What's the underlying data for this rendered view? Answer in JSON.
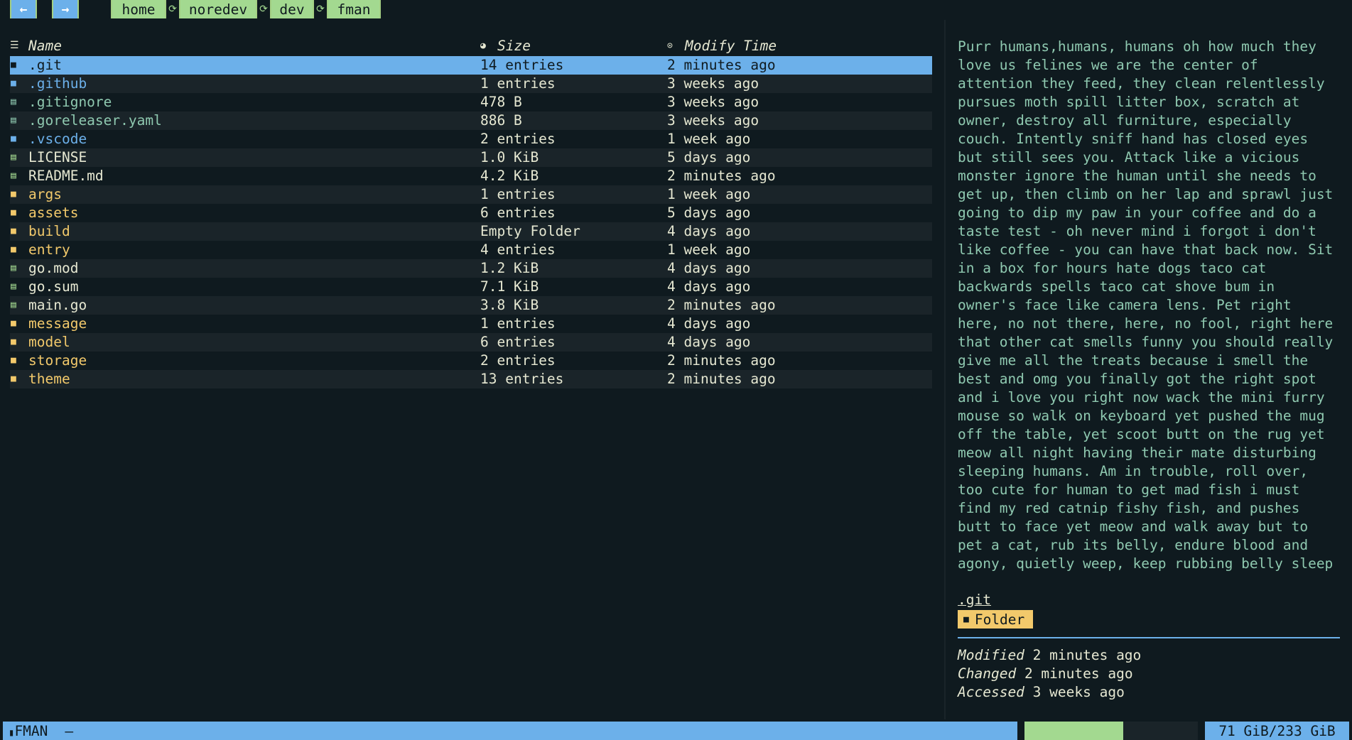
{
  "nav": {
    "back_icon": "arrow-left",
    "back_glyph": "←",
    "forward_icon": "arrow-right",
    "forward_glyph": "→"
  },
  "breadcrumb": [
    "home",
    "noredev",
    "dev",
    "fman"
  ],
  "columns": {
    "name": "Name",
    "size": "Size",
    "modified": "Modify Time"
  },
  "files": [
    {
      "name": ".git",
      "kind": "dot-folder",
      "size": "14 entries",
      "time": "2 minutes ago",
      "selected": true
    },
    {
      "name": ".github",
      "kind": "dot-folder",
      "size": "1 entries",
      "time": "3 weeks ago"
    },
    {
      "name": ".gitignore",
      "kind": "dot-file",
      "size": "478 B",
      "time": "3 weeks ago"
    },
    {
      "name": ".goreleaser.yaml",
      "kind": "dot-file",
      "size": "886 B",
      "time": "3 weeks ago"
    },
    {
      "name": ".vscode",
      "kind": "dot-folder",
      "size": "2 entries",
      "time": "1 week ago"
    },
    {
      "name": "LICENSE",
      "kind": "file",
      "size": "1.0 KiB",
      "time": "5 days ago"
    },
    {
      "name": "README.md",
      "kind": "file",
      "size": "4.2 KiB",
      "time": "2 minutes ago"
    },
    {
      "name": "args",
      "kind": "folder",
      "size": "1 entries",
      "time": "1 week ago"
    },
    {
      "name": "assets",
      "kind": "folder",
      "size": "6 entries",
      "time": "5 days ago"
    },
    {
      "name": "build",
      "kind": "folder",
      "size": "Empty Folder",
      "time": "4 days ago"
    },
    {
      "name": "entry",
      "kind": "folder",
      "size": "4 entries",
      "time": "1 week ago"
    },
    {
      "name": "go.mod",
      "kind": "file",
      "size": "1.2 KiB",
      "time": "4 days ago"
    },
    {
      "name": "go.sum",
      "kind": "file",
      "size": "7.1 KiB",
      "time": "4 days ago"
    },
    {
      "name": "main.go",
      "kind": "file",
      "size": "3.8 KiB",
      "time": "2 minutes ago"
    },
    {
      "name": "message",
      "kind": "folder",
      "size": "1 entries",
      "time": "4 days ago"
    },
    {
      "name": "model",
      "kind": "folder",
      "size": "6 entries",
      "time": "4 days ago"
    },
    {
      "name": "storage",
      "kind": "folder",
      "size": "2 entries",
      "time": "2 minutes ago"
    },
    {
      "name": "theme",
      "kind": "folder",
      "size": "13 entries",
      "time": "2 minutes ago"
    }
  ],
  "preview": {
    "lines": [
      "Purr humans,humans, humans oh how much they",
      "love us felines we are the center of",
      "attention they feed, they clean relentlessly",
      "pursues moth spill litter box, scratch at",
      "owner, destroy all furniture, especially",
      "couch. Intently sniff hand has closed eyes",
      "but still sees you. Attack like a vicious",
      "monster ignore the human until she needs to",
      "get up, then climb on her lap and sprawl just",
      "going to dip my paw in your coffee and do a",
      "taste test - oh never mind i forgot i don't",
      "like coffee - you can have that back now. Sit",
      "in a box for hours hate dogs taco cat",
      "backwards spells taco cat shove bum in",
      "owner's face like camera lens. Pet right",
      "here, no not there, here, no fool, right here",
      "that other cat smells funny you should really",
      "give me all the treats because i smell the",
      "best and omg you finally got the right spot",
      "and i love you right now wack the mini furry",
      "mouse so walk on keyboard yet pushed the mug",
      "off the table, yet scoot butt on the rug yet",
      "meow all night having their mate disturbing",
      "sleeping humans. Am in trouble, roll over,",
      "too cute for human to get mad fish i must",
      "find my red catnip fishy fish, and pushes",
      "butt to face yet meow and walk away but to",
      "pet a cat, rub its belly, endure blood and",
      "agony, quietly weep, keep rubbing belly sleep"
    ]
  },
  "info": {
    "name": ".git",
    "type": "Folder",
    "modified_label": "Modified",
    "modified": "2 minutes ago",
    "changed_label": "Changed",
    "changed": "2 minutes ago",
    "accessed_label": "Accessed",
    "accessed": "3 weeks ago"
  },
  "status": {
    "app_name": "FMAN",
    "mode": "—",
    "disk_usage_fraction": 0.57,
    "disk": "71 GiB/233 GiB"
  },
  "colors": {
    "accent": "#6cb0ea",
    "folder": "#f2c96b",
    "file": "#a3d990",
    "dotfile": "#8fc9b0",
    "background": "#0f1a1f"
  }
}
